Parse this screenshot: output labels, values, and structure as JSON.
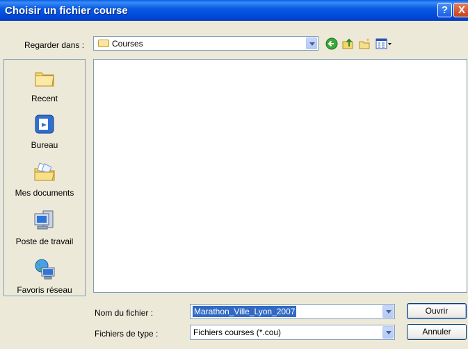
{
  "window": {
    "title": "Choisir un fichier course",
    "help_glyph": "?",
    "close_glyph": "X"
  },
  "lookin": {
    "label": "Regarder dans :",
    "value": "Courses"
  },
  "toolbar": {
    "icons": [
      "back-icon",
      "up-folder-icon",
      "new-folder-icon",
      "view-menu-icon"
    ]
  },
  "places": [
    {
      "label": "Recent",
      "icon": "recent-folder-icon"
    },
    {
      "label": "Bureau",
      "icon": "desktop-icon"
    },
    {
      "label": "Mes documents",
      "icon": "my-documents-icon"
    },
    {
      "label": "Poste de travail",
      "icon": "my-computer-icon"
    },
    {
      "label": "Favoris réseau",
      "icon": "network-places-icon"
    }
  ],
  "filename": {
    "label": "Nom du fichier :",
    "value": "Marathon_Ville_Lyon_2007"
  },
  "filetype": {
    "label": "Fichiers de type :",
    "value": "Fichiers courses (*.cou)"
  },
  "buttons": {
    "open": "Ouvrir",
    "cancel": "Annuler"
  }
}
